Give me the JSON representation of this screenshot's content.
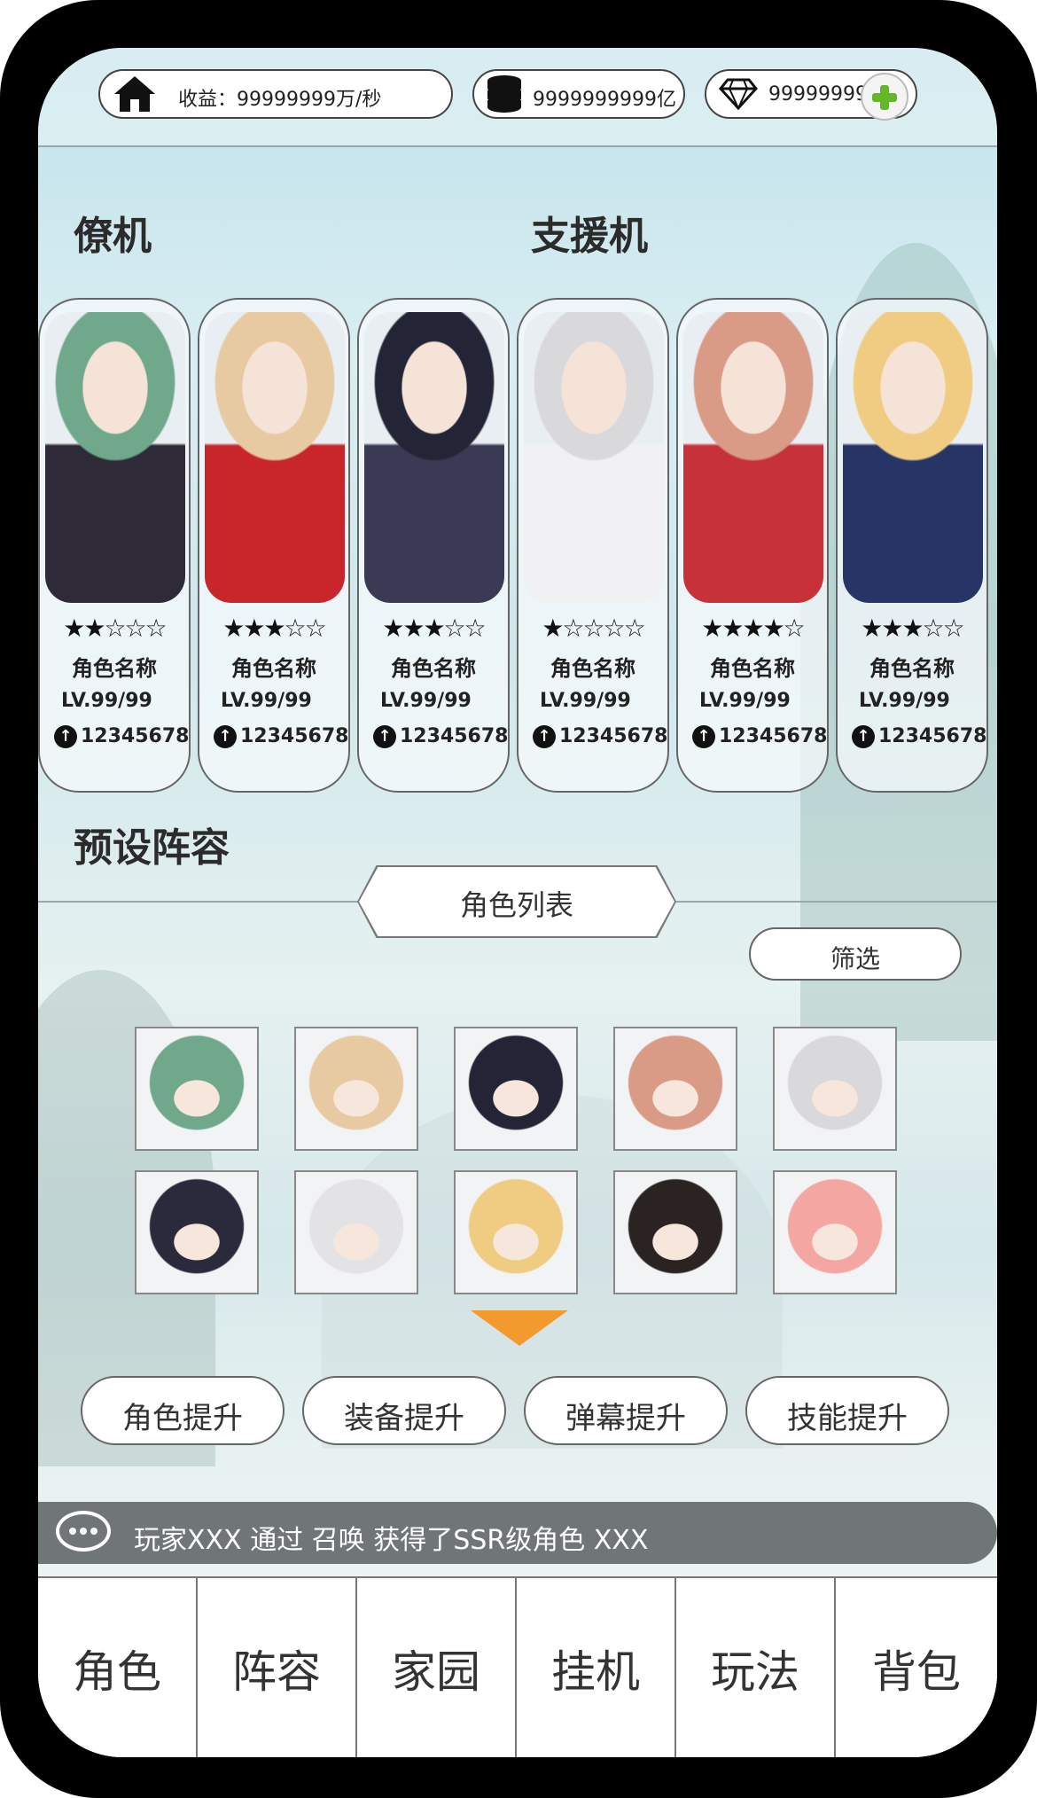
{
  "topbar": {
    "income_label": "收益：99999999万/秒",
    "coins_label": "9999999999亿",
    "gems_label": "99999999"
  },
  "sections": {
    "wingman_title": "僚机",
    "support_title": "支援机",
    "preset_title": "预设阵容",
    "role_list_title": "角色列表",
    "filter_label": "筛选"
  },
  "cards": [
    {
      "stars": "★★☆☆☆",
      "name": "角色名称",
      "level": "LV.99/99",
      "power": "12345678",
      "hair": "#6fa88a",
      "outfit": "#2e2a38"
    },
    {
      "stars": "★★★☆☆",
      "name": "角色名称",
      "level": "LV.99/99",
      "power": "12345678",
      "hair": "#e8caa2",
      "outfit": "#c8262a"
    },
    {
      "stars": "★★★☆☆",
      "name": "角色名称",
      "level": "LV.99/99",
      "power": "12345678",
      "hair": "#232536",
      "outfit": "#3b3a55"
    },
    {
      "stars": "★☆☆☆☆",
      "name": "角色名称",
      "level": "LV.99/99",
      "power": "12345678",
      "hair": "#d9d9dc",
      "outfit": "#f1f1f3"
    },
    {
      "stars": "★★★★☆",
      "name": "角色名称",
      "level": "LV.99/99",
      "power": "12345678",
      "hair": "#d99a86",
      "outfit": "#c7323a"
    },
    {
      "stars": "★★★☆☆",
      "name": "角色名称",
      "level": "LV.99/99",
      "power": "12345678",
      "hair": "#f0cc82",
      "outfit": "#263566"
    }
  ],
  "roster": [
    {
      "hair": "#6fa88a"
    },
    {
      "hair": "#e8caa2"
    },
    {
      "hair": "#232536"
    },
    {
      "hair": "#d99a86"
    },
    {
      "hair": "#d9d9dc"
    },
    {
      "hair": "#2b2a3c"
    },
    {
      "hair": "#e3e3e6"
    },
    {
      "hair": "#f0cc82"
    },
    {
      "hair": "#2a2322"
    },
    {
      "hair": "#f4a6a2"
    }
  ],
  "actions": {
    "role_upgrade": "角色提升",
    "equip_upgrade": "装备提升",
    "barrage_upgrade": "弹幕提升",
    "skill_upgrade": "技能提升"
  },
  "ticker": {
    "message": "玩家XXX 通过 召唤 获得了SSR级角色 XXX"
  },
  "nav": [
    "角色",
    "阵容",
    "家园",
    "挂机",
    "玩法",
    "背包"
  ],
  "colors": {
    "accent_orange": "#f29a2e",
    "plus_green": "#63b82a"
  }
}
